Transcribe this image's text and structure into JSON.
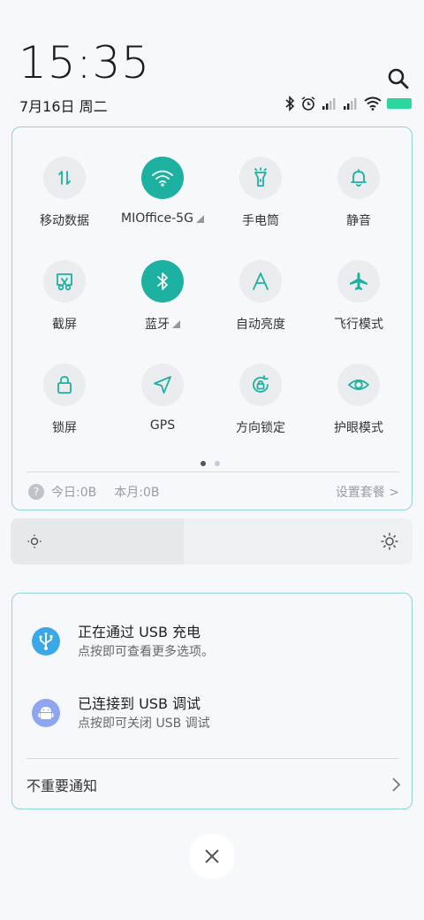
{
  "status": {
    "time": "15:35",
    "date": "7月16日 周二",
    "icons": [
      "bluetooth-icon",
      "alarm-icon",
      "signal-icon",
      "signal-icon",
      "wifi-icon",
      "battery-icon"
    ],
    "battery_color": "#2ed69f"
  },
  "quick_settings": {
    "tiles": [
      {
        "label": "移动数据",
        "icon": "mobile-data-icon",
        "active": false
      },
      {
        "label": "MIOffice-5G",
        "icon": "wifi-icon",
        "active": true,
        "has_menu": true
      },
      {
        "label": "手电筒",
        "icon": "flashlight-icon",
        "active": false
      },
      {
        "label": "静音",
        "icon": "bell-icon",
        "active": false
      },
      {
        "label": "截屏",
        "icon": "screenshot-icon",
        "active": false
      },
      {
        "label": "蓝牙",
        "icon": "bluetooth-icon",
        "active": true,
        "has_menu": true
      },
      {
        "label": "自动亮度",
        "icon": "auto-brightness-icon",
        "active": false
      },
      {
        "label": "飞行模式",
        "icon": "airplane-icon",
        "active": false
      },
      {
        "label": "锁屏",
        "icon": "lock-icon",
        "active": false
      },
      {
        "label": "GPS",
        "icon": "location-arrow-icon",
        "active": false
      },
      {
        "label": "方向锁定",
        "icon": "rotation-lock-icon",
        "active": false
      },
      {
        "label": "护眼模式",
        "icon": "eye-icon",
        "active": false
      }
    ],
    "page_count": 2,
    "current_page": 1,
    "accent_color": "#1cb1a0",
    "usage": {
      "today": "今日:0B",
      "month": "本月:0B",
      "settings_link": "设置套餐 >"
    }
  },
  "brightness": {
    "level": 0.43
  },
  "notifications": {
    "items": [
      {
        "title": "正在通过  USB  充电",
        "subtitle": "点按即可查看更多选项。",
        "icon": "usb-icon",
        "icon_color": "#3aa7e6"
      },
      {
        "title": "已连接到  USB  调试",
        "subtitle": "点按即可关闭 USB 调试",
        "icon": "android-icon",
        "icon_color": "#8ea6f0"
      }
    ],
    "unimportant_label": "不重要通知"
  }
}
